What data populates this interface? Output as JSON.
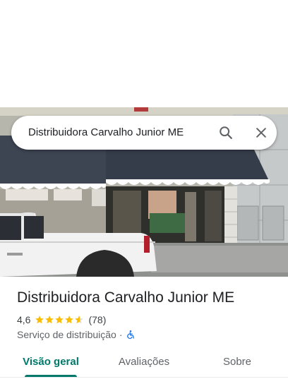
{
  "search": {
    "query": "Distribuidora Carvalho Junior ME",
    "search_icon": "search-icon",
    "close_icon": "close-icon"
  },
  "photo": {
    "description_icon": "storefront-photo"
  },
  "place": {
    "title": "Distribuidora Carvalho Junior ME",
    "rating": "4,6",
    "rating_stars": 4.6,
    "reviews_count": "(78)",
    "category": "Serviço de distribuição",
    "separator": "·",
    "accessibility_icon": "wheelchair-icon"
  },
  "tabs": [
    {
      "label": "Visão geral",
      "active": true
    },
    {
      "label": "Avaliações",
      "active": false
    },
    {
      "label": "Sobre",
      "active": false
    }
  ],
  "colors": {
    "accent": "#00796b",
    "star": "#fbbc04",
    "access_blue": "#1a73e8"
  }
}
